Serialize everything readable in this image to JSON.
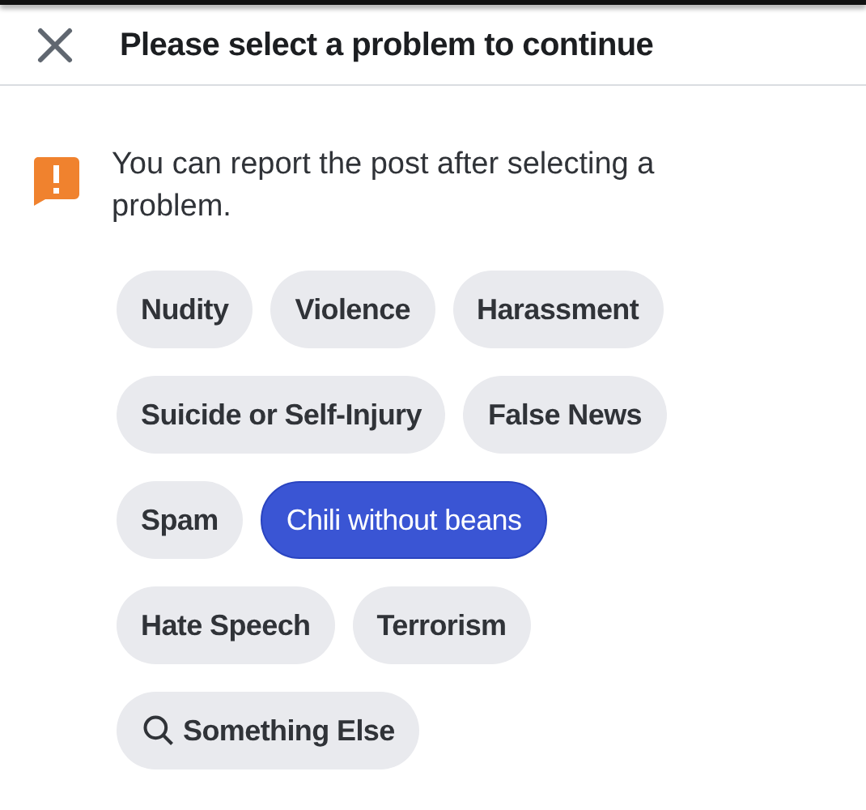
{
  "header": {
    "title": "Please select a problem to continue"
  },
  "notice": {
    "text": "You can report the post after selecting a problem."
  },
  "chip_rows": [
    [
      {
        "label": "Nudity",
        "selected": false,
        "kind": "plain"
      },
      {
        "label": "Violence",
        "selected": false,
        "kind": "plain"
      },
      {
        "label": "Harassment",
        "selected": false,
        "kind": "plain"
      }
    ],
    [
      {
        "label": "Suicide or Self-Injury",
        "selected": false,
        "kind": "plain"
      },
      {
        "label": "False News",
        "selected": false,
        "kind": "plain"
      }
    ],
    [
      {
        "label": "Spam",
        "selected": false,
        "kind": "plain"
      },
      {
        "label": "Chili without beans",
        "selected": true,
        "kind": "plain"
      }
    ],
    [
      {
        "label": "Hate Speech",
        "selected": false,
        "kind": "plain"
      },
      {
        "label": "Terrorism",
        "selected": false,
        "kind": "plain"
      }
    ],
    [
      {
        "label": "Something Else",
        "selected": false,
        "kind": "search"
      }
    ]
  ]
}
